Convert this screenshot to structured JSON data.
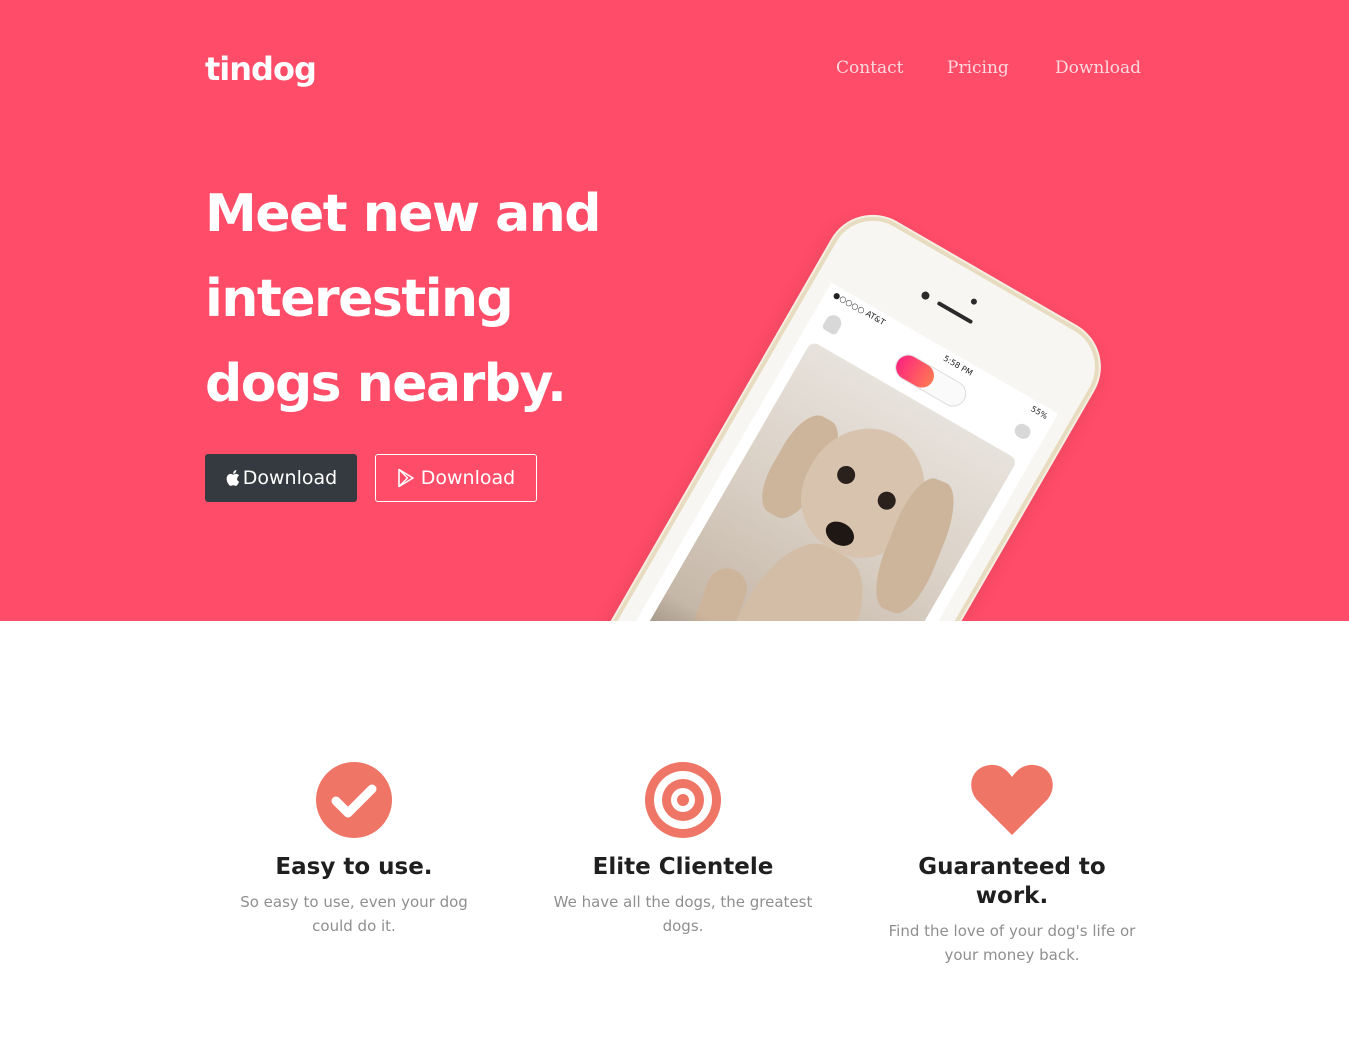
{
  "brand": {
    "name": "tindog"
  },
  "nav": {
    "items": [
      {
        "label": "Contact"
      },
      {
        "label": "Pricing"
      },
      {
        "label": "Download"
      }
    ]
  },
  "hero": {
    "headline_line1": "Meet new and",
    "headline_line2": "interesting",
    "headline_line3": "dogs nearby.",
    "buttons": [
      {
        "label": "Download",
        "icon": "apple-icon"
      },
      {
        "label": "Download",
        "icon": "google-play-icon"
      }
    ],
    "phone": {
      "carrier": "●○○○○ AT&T",
      "time": "5:58 PM",
      "battery": "55%"
    }
  },
  "features": [
    {
      "icon": "check-circle-icon",
      "title": "Easy to use.",
      "text": "So easy to use, even your dog could do it."
    },
    {
      "icon": "bullseye-icon",
      "title": "Elite Clientele",
      "text": "We have all the dogs, the greatest dogs."
    },
    {
      "icon": "heart-icon",
      "title": "Guaranteed to work.",
      "text": "Find the love of your dog's life or your money back."
    }
  ],
  "colors": {
    "hero_bg": "#ff4c68",
    "icon_accent": "#ef7566",
    "dark_button": "#343a40"
  }
}
